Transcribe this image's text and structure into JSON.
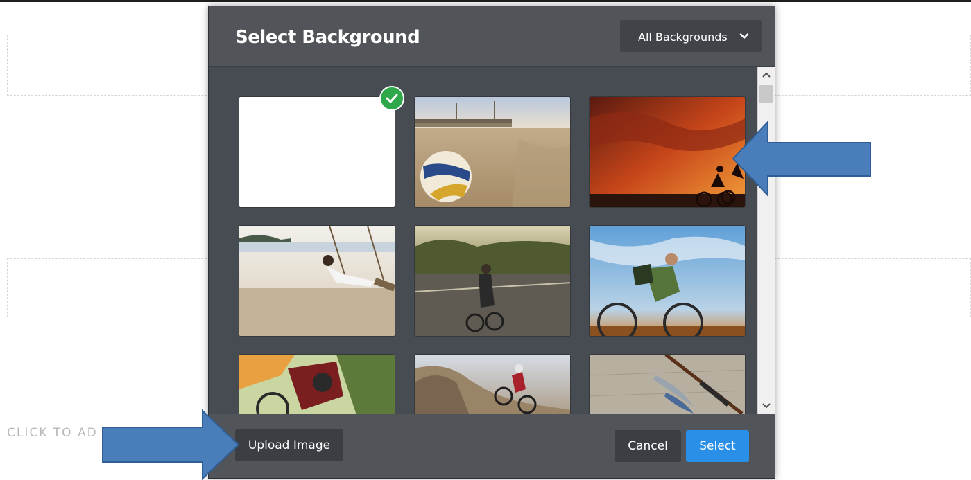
{
  "page": {
    "cta_text": "CLICK TO AD"
  },
  "modal": {
    "title": "Select Background",
    "filter": {
      "selected": "All Backgrounds",
      "icon": "chevron-down-icon"
    },
    "grid": {
      "thumbnails": [
        {
          "name": "thumb-blank-white",
          "selected": true
        },
        {
          "name": "thumb-volleyball-beach",
          "selected": false
        },
        {
          "name": "thumb-sunset-cyclists",
          "selected": false
        },
        {
          "name": "thumb-beach-swing",
          "selected": false
        },
        {
          "name": "thumb-road-cyclist",
          "selected": false
        },
        {
          "name": "thumb-cyclist-blue-sky",
          "selected": false
        },
        {
          "name": "thumb-cyclist-closeup",
          "selected": false
        },
        {
          "name": "thumb-bmx-rocks",
          "selected": false
        },
        {
          "name": "thumb-fishing-rod",
          "selected": false
        }
      ],
      "selected_icon": "check-icon"
    },
    "footer": {
      "upload_label": "Upload Image",
      "cancel_label": "Cancel",
      "select_label": "Select"
    }
  },
  "colors": {
    "select_button": "#2a8fe6",
    "check_badge": "#2ea84a",
    "annotation_arrow": "#4a7ebb"
  }
}
